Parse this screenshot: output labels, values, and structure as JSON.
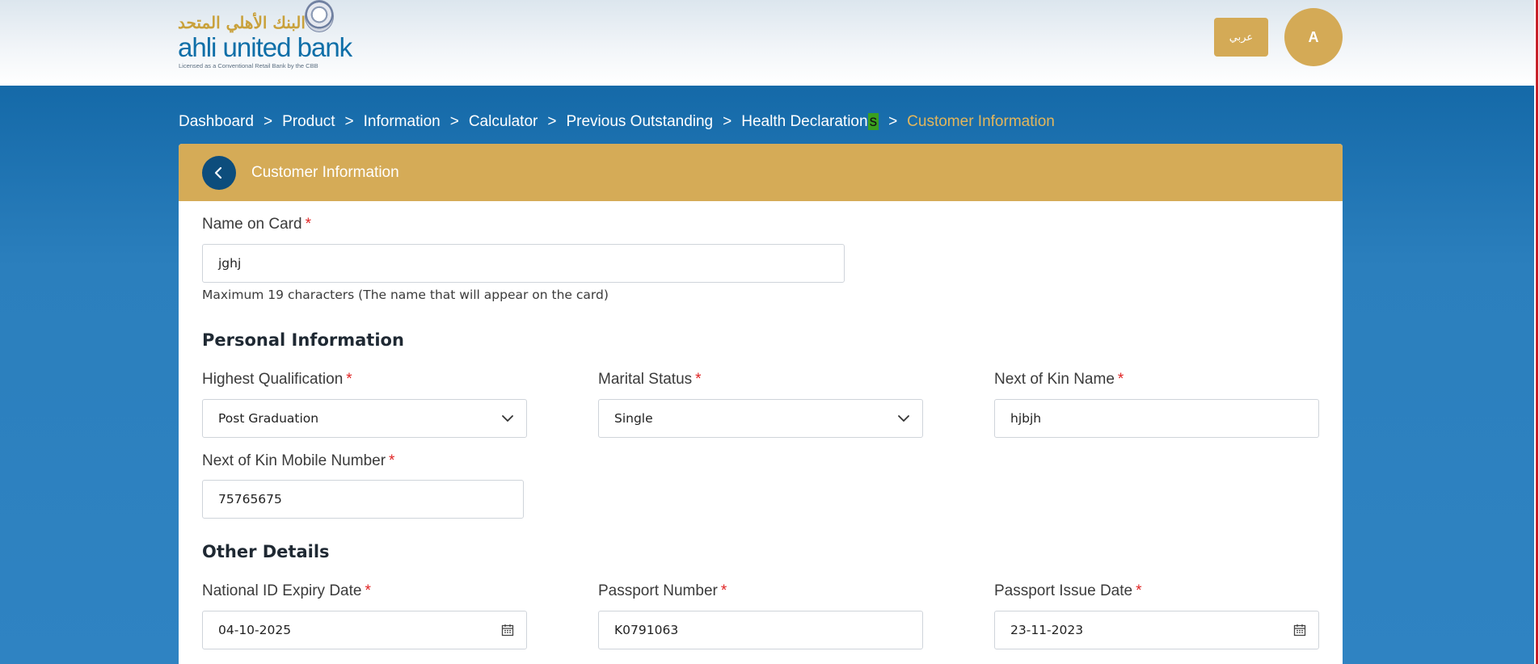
{
  "header": {
    "logo_arabic": "البنك الأهلي المتحد",
    "logo_name": "ahli united bank",
    "logo_tagline": "Licensed as a Conventional Retail Bank by the CBB",
    "lang_button": "عربي",
    "avatar_initial": "A"
  },
  "breadcrumb": {
    "items": [
      "Dashboard",
      "Product",
      "Information",
      "Calculator",
      "Previous Outstanding",
      "Health Declaration",
      "Customer Information"
    ],
    "highlight_char": "s",
    "separator": ">"
  },
  "card": {
    "title": "Customer Information",
    "back_icon": "chevron-left-icon"
  },
  "form": {
    "name_on_card": {
      "label": "Name on Card",
      "value": "jghj",
      "hint": "Maximum 19 characters (The name that will appear on the card)"
    },
    "personal_section": "Personal Information",
    "highest_qualification": {
      "label": "Highest Qualification",
      "value": "Post Graduation"
    },
    "marital_status": {
      "label": "Marital Status",
      "value": "Single"
    },
    "next_of_kin_name": {
      "label": "Next of Kin Name",
      "value": "hjbjh"
    },
    "next_of_kin_mobile": {
      "label": "Next of Kin Mobile Number",
      "value": "75765675"
    },
    "other_section": "Other Details",
    "national_id_expiry": {
      "label": "National ID Expiry Date",
      "value": "04-10-2025"
    },
    "passport_number": {
      "label": "Passport Number",
      "value": "K0791063"
    },
    "passport_issue_date": {
      "label": "Passport Issue Date",
      "value": "23-11-2023"
    },
    "required_mark": "*"
  },
  "colors": {
    "gold": "#d5ab57",
    "navy": "#0d4d7c",
    "active_crumb": "#e3b65c",
    "required": "#e02424"
  }
}
